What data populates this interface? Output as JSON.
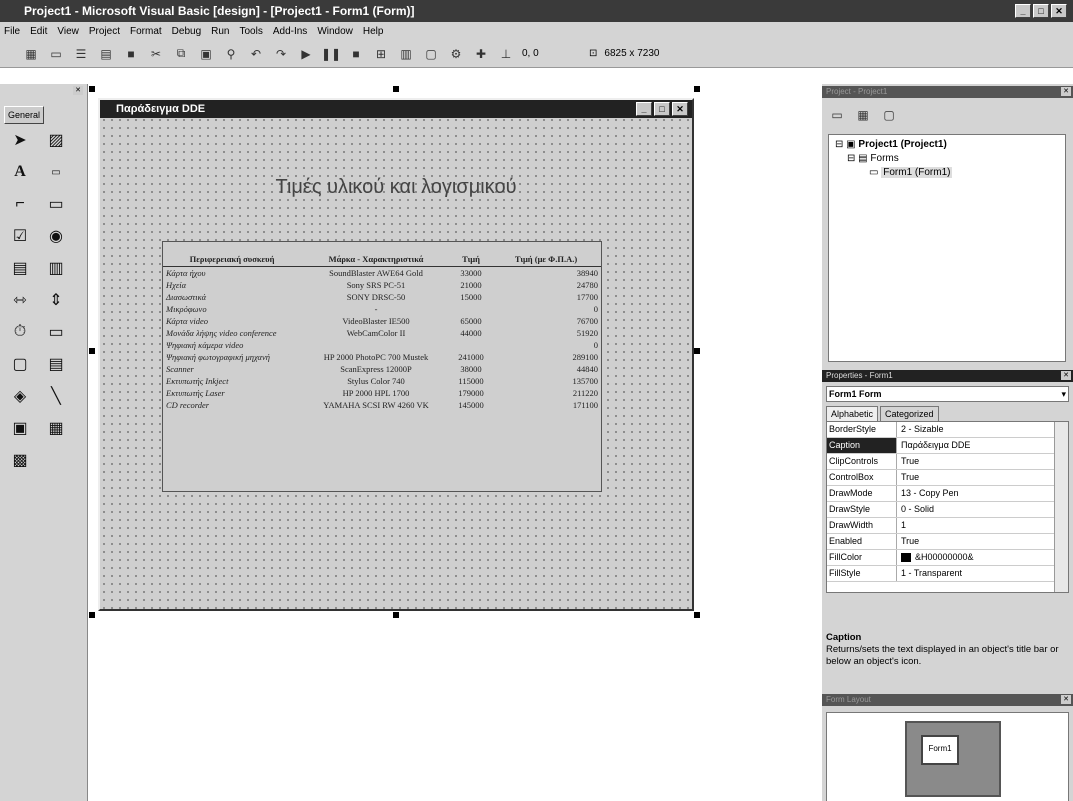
{
  "window": {
    "title": "Project1 - Microsoft Visual Basic [design] - [Project1 - Form1 (Form)]"
  },
  "menu": [
    "File",
    "Edit",
    "View",
    "Project",
    "Format",
    "Debug",
    "Run",
    "Tools",
    "Add-Ins",
    "Window",
    "Help"
  ],
  "toolbar": {
    "coords": "0, 0",
    "size": "6825 x 7230"
  },
  "toolbox": {
    "tab": "General"
  },
  "form": {
    "caption": "Παράδειγμα DDE",
    "heading": "Τιμές υλικού και λογισμικού",
    "table": {
      "headers": [
        "Περιφερειακή συσκευή",
        "Μάρκα - Χαρακτηριστικά",
        "Τιμή",
        "Τιμή (με Φ.Π.Α.)"
      ],
      "rows": [
        [
          "Κάρτα ήχου",
          "SoundBlaster AWE64 Gold",
          "33000",
          "38940"
        ],
        [
          "Ηχεία",
          "Sony SRS PC-51",
          "21000",
          "24780"
        ],
        [
          "Διασωστικά",
          "SONY DRSC-50",
          "15000",
          "17700"
        ],
        [
          "Μικρόφωνο",
          "-",
          "",
          "0"
        ],
        [
          "Κάρτα video",
          "VideoBlaster IE500",
          "65000",
          "76700"
        ],
        [
          "Μονάδα λήψης video conference",
          "WebCamColor II",
          "44000",
          "51920"
        ],
        [
          "Ψηφιακή κάμερα video",
          "",
          "",
          "0"
        ],
        [
          "Ψηφιακή φωτογραφική μηχανή",
          "HP 2000 PhotoPC 700 Mustek",
          "241000",
          "289100"
        ],
        [
          "Scanner",
          "ScanExpress 12000P",
          "38000",
          "44840"
        ],
        [
          "Εκτυπωτής Inkject",
          "Stylus Color 740",
          "115000",
          "135700"
        ],
        [
          "Εκτυπωτής Laser",
          "HP 2000 HPL 1700",
          "179000",
          "211220"
        ],
        [
          "CD recorder",
          "YAMAHA SCSI RW 4260 VK",
          "145000",
          "171100"
        ]
      ]
    }
  },
  "project": {
    "title": "Project - Project1",
    "root": "Project1 (Project1)",
    "folder": "Forms",
    "item": "Form1 (Form1)"
  },
  "properties": {
    "title": "Properties - Form1",
    "object": "Form1 Form",
    "tabs": [
      "Alphabetic",
      "Categorized"
    ],
    "rows": [
      [
        "BorderStyle",
        "2 - Sizable"
      ],
      [
        "Caption",
        "Παράδειγμα DDE"
      ],
      [
        "ClipControls",
        "True"
      ],
      [
        "ControlBox",
        "True"
      ],
      [
        "DrawMode",
        "13 - Copy Pen"
      ],
      [
        "DrawStyle",
        "0 - Solid"
      ],
      [
        "DrawWidth",
        "1"
      ],
      [
        "Enabled",
        "True"
      ],
      [
        "FillColor",
        "&H00000000&"
      ],
      [
        "FillStyle",
        "1 - Transparent"
      ]
    ],
    "desc_title": "Caption",
    "desc_text": "Returns/sets the text displayed in an object's title bar or below an object's icon."
  },
  "layout": {
    "title": "Form Layout",
    "form_label": "Form1"
  }
}
